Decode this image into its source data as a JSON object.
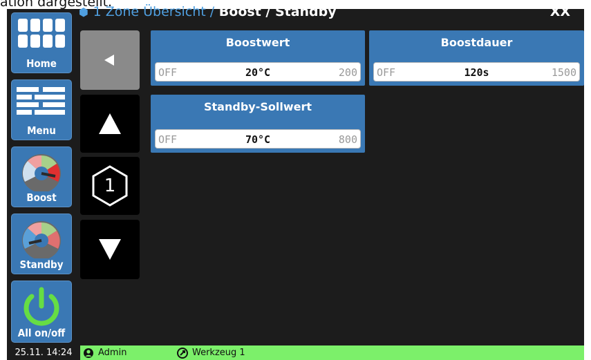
{
  "overlay_text": "ation dargestellt.",
  "header": {
    "zone_label": "1 Zone Übersicht /",
    "page_title": "Boost / Standby",
    "right_label": "XX"
  },
  "sidebar": {
    "items": [
      {
        "label": "Home",
        "icon": "home-grid-icon"
      },
      {
        "label": "Menu",
        "icon": "menu-icon"
      },
      {
        "label": "Boost",
        "icon": "boost-gauge-icon"
      },
      {
        "label": "Standby",
        "icon": "standby-gauge-icon"
      },
      {
        "label": "All on/off",
        "icon": "power-icon"
      }
    ]
  },
  "nav": {
    "zone_number": "1"
  },
  "params": [
    {
      "title": "Boostwert",
      "min": "OFF",
      "value": "20°C",
      "max": "200"
    },
    {
      "title": "Boostdauer",
      "min": "OFF",
      "value": "120s",
      "max": "1500"
    },
    {
      "title": "Standby-Sollwert",
      "min": "OFF",
      "value": "70°C",
      "max": "800"
    }
  ],
  "status": {
    "datetime": "25.11. 14:24",
    "user": "Admin",
    "tool": "Werkzeug 1"
  },
  "colors": {
    "panel_blue": "#3a78b4",
    "status_green": "#7cf06a",
    "accent_blue": "#4f9fe0"
  }
}
